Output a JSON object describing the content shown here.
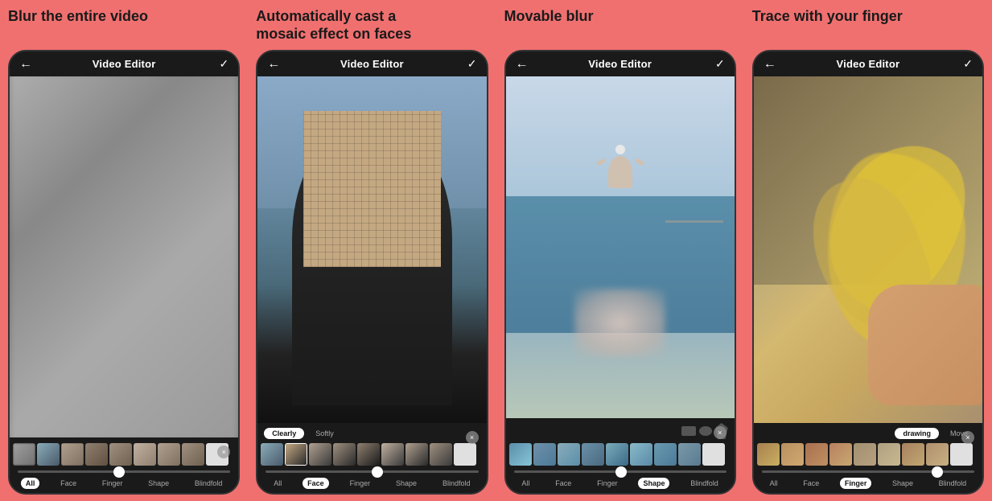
{
  "panels": [
    {
      "id": "blur-video",
      "title": "Blur the entire video",
      "header_title": "Video Editor",
      "back_icon": "←",
      "check_icon": "✓",
      "close_icon": "×",
      "tabs": [
        "All",
        "Face",
        "Finger",
        "Shape",
        "Blindfold"
      ],
      "active_tab": "All",
      "type": "blur"
    },
    {
      "id": "mosaic-face",
      "title": "Automatically cast a\nmosaic effect on faces",
      "header_title": "Video Editor",
      "back_icon": "←",
      "check_icon": "✓",
      "close_icon": "×",
      "tabs": [
        "All",
        "Face",
        "Finger",
        "Shape",
        "Blindfold"
      ],
      "active_tab": "Face",
      "toggle": [
        "Clearly",
        "Softly"
      ],
      "active_toggle": "Clearly",
      "type": "mosaic"
    },
    {
      "id": "movable-blur",
      "title": "Movable blur",
      "header_title": "Video Editor",
      "back_icon": "←",
      "check_icon": "✓",
      "close_icon": "×",
      "tabs": [
        "All",
        "Face",
        "Finger",
        "Shape",
        "Blindfold"
      ],
      "active_tab": "Shape",
      "type": "movable"
    },
    {
      "id": "trace-finger",
      "title": "Trace with your finger",
      "header_title": "Video Editor",
      "back_icon": "←",
      "check_icon": "✓",
      "close_icon": "×",
      "tabs": [
        "All",
        "Face",
        "Finger",
        "Shape",
        "Blindfold"
      ],
      "active_tab": "Finger",
      "draw_toggle": [
        "drawing",
        "Move"
      ],
      "active_draw": "drawing",
      "type": "trace"
    }
  ],
  "colors": {
    "bg": "#f07070",
    "phone_bg": "#111",
    "header_bg": "#1a1a1a",
    "footer_bg": "#1a1a1a",
    "text_white": "#ffffff",
    "text_dark": "#1a1a1a",
    "active_tab_bg": "#ffffff",
    "slider_thumb": "#ffffff",
    "close_btn_bg": "rgba(150,150,150,0.7)"
  }
}
